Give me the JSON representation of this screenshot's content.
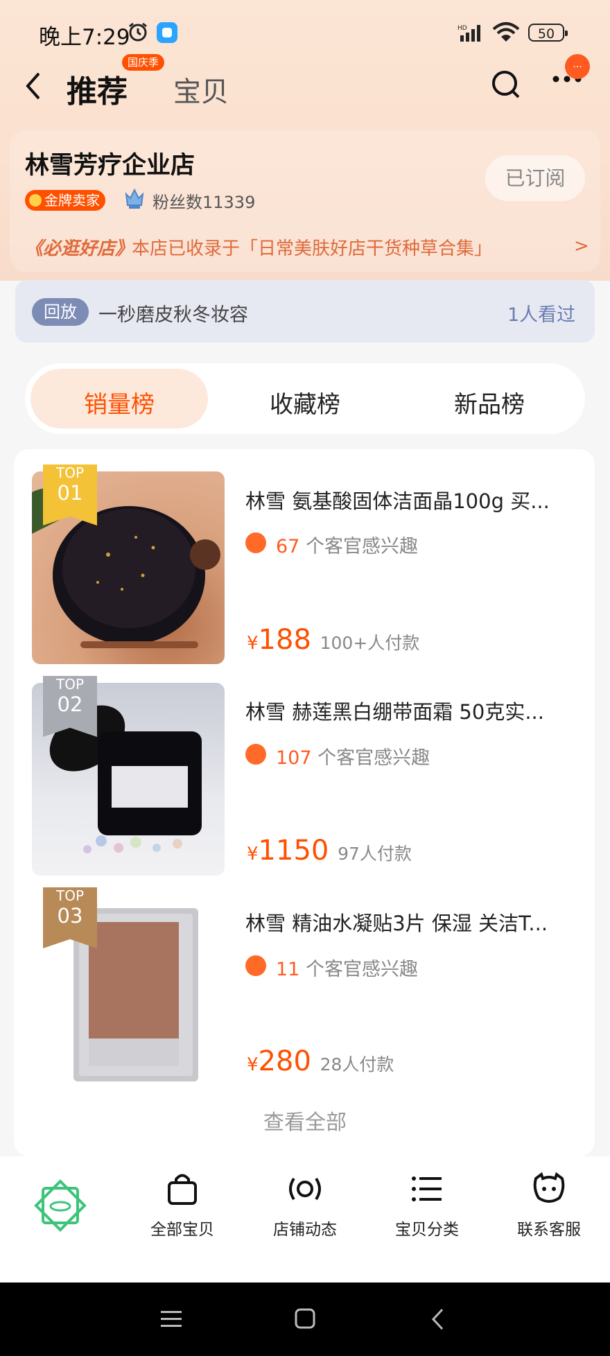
{
  "status_bar": {
    "time": "晚上7:29",
    "battery": "50"
  },
  "nav": {
    "active_tab": "推荐",
    "festival_badge": "国庆季",
    "other_tab": "宝贝",
    "notification": "..."
  },
  "shop": {
    "name": "林雪芳疗企业店",
    "subscribe_label": "已订阅",
    "gold_badge": "金牌卖家",
    "fans": "粉丝数11339",
    "must_visit": "《必逛好店》",
    "collected_in": "本店已收录于「日常美肤好店干货种草合集」"
  },
  "replay": {
    "badge": "回放",
    "title": "一秒磨皮秋冬妆容",
    "viewed": "1人看过"
  },
  "rank_tabs": [
    "销量榜",
    "收藏榜",
    "新品榜"
  ],
  "products": [
    {
      "top_label": "TOP",
      "rank": "01",
      "title": "林雪 氨基酸固体洁面晶100g 买...",
      "interest_count": "67",
      "interest_text": "个客官感兴趣",
      "currency": "¥",
      "price": "188",
      "paid": "100+人付款"
    },
    {
      "top_label": "TOP",
      "rank": "02",
      "title": "林雪 赫莲黑白绷带面霜 50克实...",
      "interest_count": "107",
      "interest_text": "个客官感兴趣",
      "currency": "¥",
      "price": "1150",
      "paid": "97人付款"
    },
    {
      "top_label": "TOP",
      "rank": "03",
      "title": "林雪 精油水凝贴3片 保湿 关洁T...",
      "interest_count": "11",
      "interest_text": "个客官感兴趣",
      "currency": "¥",
      "price": "280",
      "paid": "28人付款"
    }
  ],
  "view_all": "查看全部",
  "bottom_nav": [
    "全部宝贝",
    "店铺动态",
    "宝贝分类",
    "联系客服"
  ],
  "colors": {
    "accent": "#ff5000",
    "gold": "#f3c237",
    "silver": "#a9abb3",
    "bronze": "#b88a57"
  }
}
